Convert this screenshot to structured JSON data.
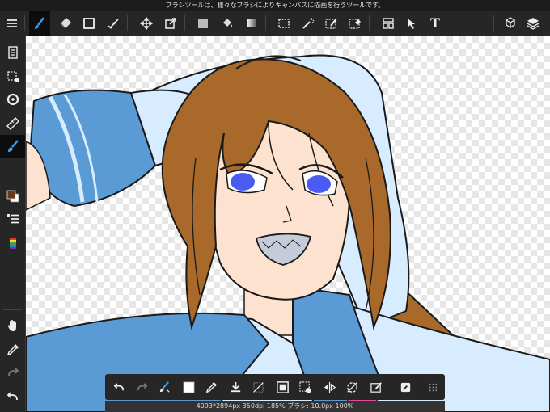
{
  "hint_bar": {
    "text": "ブラシツールは、様々なブラシによりキャンバスに描画を行うツールです。"
  },
  "toolbar": {
    "menu": "menu-icon",
    "tools": [
      "brush-icon",
      "eraser-icon",
      "rectangle-shape-icon",
      "curve-icon",
      "move-icon",
      "transform-icon",
      "fill-color-icon",
      "bucket-icon",
      "gradient-icon",
      "rect-select-icon",
      "magic-wand-icon",
      "select-pen-icon",
      "select-eraser-icon",
      "filter-icon",
      "pointer-icon",
      "text-icon"
    ],
    "text_tool_label": "T",
    "right": [
      "materials-icon",
      "layers-icon"
    ]
  },
  "sidebar": {
    "items": [
      "page-manager-icon",
      "selection-icon",
      "snap-icon",
      "ruler-icon",
      "brush-tool-icon",
      "color-swatch",
      "layer-list-icon",
      "palette-icon",
      "hand-icon",
      "eyedropper-icon",
      "redo-icon",
      "undo-icon"
    ]
  },
  "bottom_bar": {
    "items": [
      "undo-icon",
      "redo-icon",
      "quick-brush-icon",
      "color-swatch",
      "eyedropper-icon",
      "save-icon",
      "deselect-icon",
      "invert-selection-icon",
      "selection-mode-icon",
      "flip-icon",
      "rotate-icon",
      "snap-off-icon",
      "edit-icon",
      "more-icon"
    ]
  },
  "status": {
    "text": "4093*2894px 350dpi 185% ブラシ: 10.0px 100%"
  },
  "colors": {
    "bg": "#262626",
    "accent": "#3aa0f0",
    "fg_swatch": "#6b3a1a",
    "bg_swatch": "#ffffff"
  }
}
